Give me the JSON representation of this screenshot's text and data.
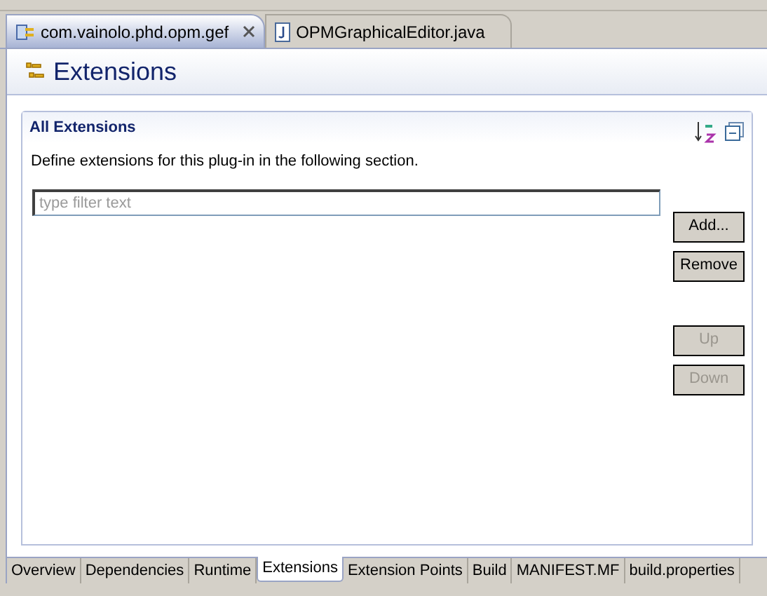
{
  "editor_tabs": [
    {
      "label": "com.vainolo.phd.opm.gef",
      "kind": "plugin",
      "selected": true,
      "closable": true
    },
    {
      "label": "OPMGraphicalEditor.java",
      "kind": "java",
      "selected": false,
      "closable": false
    }
  ],
  "page_title": "Extensions",
  "section": {
    "title": "All Extensions",
    "description": "Define extensions for this plug-in in the following section.",
    "filter": {
      "placeholder": "type filter text"
    },
    "buttons": [
      {
        "label": "Add...",
        "disabled": false
      },
      {
        "label": "Remove",
        "disabled": false
      },
      {
        "label": "Up",
        "disabled": true
      },
      {
        "label": "Down",
        "disabled": true
      }
    ]
  },
  "page_tabs": [
    {
      "label": "Overview",
      "selected": false
    },
    {
      "label": "Dependencies",
      "selected": false
    },
    {
      "label": "Runtime",
      "selected": false
    },
    {
      "label": "Extensions",
      "selected": true
    },
    {
      "label": "Extension Points",
      "selected": false
    },
    {
      "label": "Build",
      "selected": false
    },
    {
      "label": "MANIFEST.MF",
      "selected": false
    },
    {
      "label": "build.properties",
      "selected": false
    }
  ]
}
